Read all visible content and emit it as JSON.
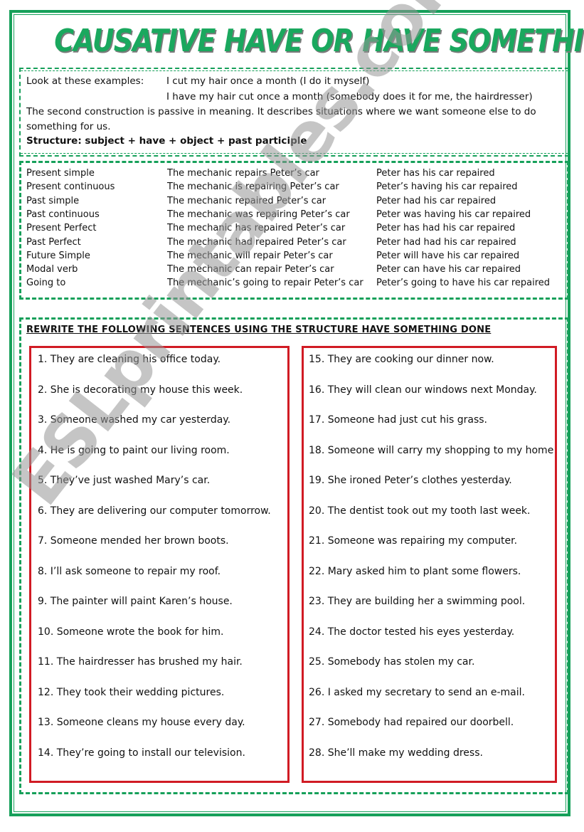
{
  "title": "CAUSATIVE HAVE OR HAVE SOMETHING DONE",
  "intro": {
    "label": "Look at these examples:",
    "example1": "I cut my hair once a month (I do it myself)",
    "example2": "I have my hair cut once a month (somebody does it for me, the hairdresser)",
    "explanation_line1": "The second construction is passive in meaning. It describes situations where we want someone else to do",
    "explanation_line2": "something for us.",
    "structure": "Structure: subject + have + object + past participle"
  },
  "tenses": [
    {
      "tense": "Present simple",
      "active": "The mechanic repairs Peter’s car",
      "causative": "Peter has his car repaired"
    },
    {
      "tense": "Present continuous",
      "active": "The mechanic is repairing Peter’s car",
      "causative": "Peter’s having his car repaired"
    },
    {
      "tense": "Past simple",
      "active": "The mechanic repaired Peter’s car",
      "causative": "Peter had his car repaired"
    },
    {
      "tense": "Past continuous",
      "active": "The mechanic was repairing Peter’s car",
      "causative": "Peter was having his car repaired"
    },
    {
      "tense": "Present Perfect",
      "active": "The mechanic has repaired Peter’s car",
      "causative": "Peter has had his car repaired"
    },
    {
      "tense": "Past Perfect",
      "active": "The mechanic had repaired Peter’s car",
      "causative": "Peter had had his car repaired"
    },
    {
      "tense": "Future Simple",
      "active": "The mechanic will repair Peter’s car",
      "causative": "Peter will have his car repaired"
    },
    {
      "tense": "Modal verb",
      "active": "The mechanic can repair Peter’s car",
      "causative": "Peter can have his car repaired"
    },
    {
      "tense": "Going to",
      "active": "The mechanic’s going to repair Peter’s car",
      "causative": "Peter’s going to have his car repaired"
    }
  ],
  "exercise": {
    "heading": "REWRITE THE FOLLOWING SENTENCES USING THE STRUCTURE HAVE SOMETHING DONE",
    "left": [
      "1. They are cleaning his office today.",
      "2. She is decorating my house this week.",
      "3. Someone washed my car yesterday.",
      "4. He is going to paint our living room.",
      "5. They’ve just washed Mary’s car.",
      "6. They are delivering our computer tomorrow.",
      "7. Someone mended her brown boots.",
      "8. I’ll ask someone to repair my roof.",
      "9. The painter will paint Karen’s house.",
      "10. Someone wrote the book for him.",
      "11. The hairdresser has brushed my hair.",
      "12. They took their wedding pictures.",
      "13. Someone cleans my house every day.",
      "14. They’re going to install our television."
    ],
    "right": [
      "15. They are cooking our dinner now.",
      "16. They will clean our windows next Monday.",
      "17. Someone had just cut his grass.",
      "18. Someone will carry my shopping to my home",
      "19. She ironed Peter’s clothes yesterday.",
      "20. The dentist took out my tooth last week.",
      "21. Someone was repairing my computer.",
      "22. Mary asked him to plant some flowers.",
      "23. They are building her a swimming pool.",
      "24. The doctor tested his eyes yesterday.",
      "25. Somebody has stolen my car.",
      "26. I asked my secretary to send an e-mail.",
      "27. Somebody had repaired our doorbell.",
      "28. She’ll make my wedding dress."
    ]
  },
  "watermark": "ESLprintables.com",
  "colors": {
    "green": "#16a05a",
    "red": "#d11b24",
    "watermark": "#969696"
  }
}
